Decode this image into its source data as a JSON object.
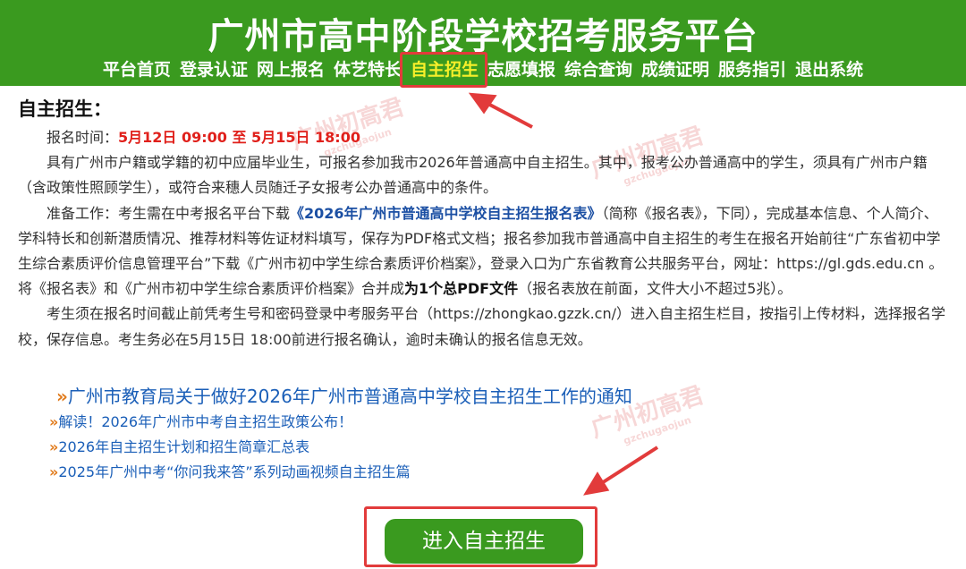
{
  "header": {
    "title": "广州市高中阶段学校招考服务平台",
    "nav": [
      {
        "label": "平台首页"
      },
      {
        "label": "登录认证"
      },
      {
        "label": "网上报名"
      },
      {
        "label": "体艺特长"
      },
      {
        "label": "自主招生",
        "active": true
      },
      {
        "label": "志愿填报"
      },
      {
        "label": "综合查询"
      },
      {
        "label": "成绩证明"
      },
      {
        "label": "服务指引"
      },
      {
        "label": "退出系统"
      }
    ]
  },
  "main": {
    "section_title": "自主招生：",
    "time_label": "报名时间：",
    "time_value": "5月12日 09:00 至 5月15日 18:00",
    "para1": "具有广州市户籍或学籍的初中应届毕业生，可报名参加我市2026年普通高中自主招生。其中，报考公办普通高中的学生，须具有广州市户籍（含政策性照顾学生），或符合来穗人员随迁子女报考公办普通高中的条件。",
    "para2_a": "准备工作：考生需在中考报名平台下载",
    "para2_form": "《2026年广州市普通高中学校自主招生报名表》",
    "para2_b": "（简称《报名表》，下同），完成基本信息、个人简介、学科特长和创新潜质情况、推荐材料等佐证材料填写，保存为PDF格式文档；报名参加我市普通高中自主招生的考生在报名开始前往“广东省初中学生综合素质评价信息管理平台”下载《广州市初中学生综合素质评价档案》，登录入口为广东省教育公共服务平台，网址：https://gl.gds.edu.cn 。将《报名表》和《广州市初中学生综合素质评价档案》合并成",
    "para2_bold": "为1个总PDF文件",
    "para2_c": "（报名表放在前面，文件大小不超过5兆）。",
    "para3": "考生须在报名时间截止前凭考生号和密码登录中考服务平台（https://zhongkao.gzzk.cn/）进入自主招生栏目，按指引上传材料，选择报名学校，保存信息。考生务必在5月15日 18:00前进行报名确认，逾时未确认的报名信息无效。"
  },
  "links": [
    {
      "arrow": "»",
      "label": "广州市教育局关于做好2026年广州市普通高中学校自主招生工作的通知"
    },
    {
      "arrow": "»",
      "label": "解读！2026年广州市中考自主招生政策公布！"
    },
    {
      "arrow": "»",
      "label": "2026年自主招生计划和招生简章汇总表"
    },
    {
      "arrow": "»",
      "label": "2025年广州中考“你问我来答”系列动画视频自主招生篇"
    }
  ],
  "enter_button": "进入自主招生",
  "watermark": {
    "text": "广州初高君",
    "sub": "gzchugaojun"
  },
  "colors": {
    "header_green": "#3a9a1f",
    "active_yellow": "#f7ef2a",
    "highlight_red": "#e23b3b",
    "link_blue": "#1b5fb8",
    "time_red": "#e0201b"
  }
}
